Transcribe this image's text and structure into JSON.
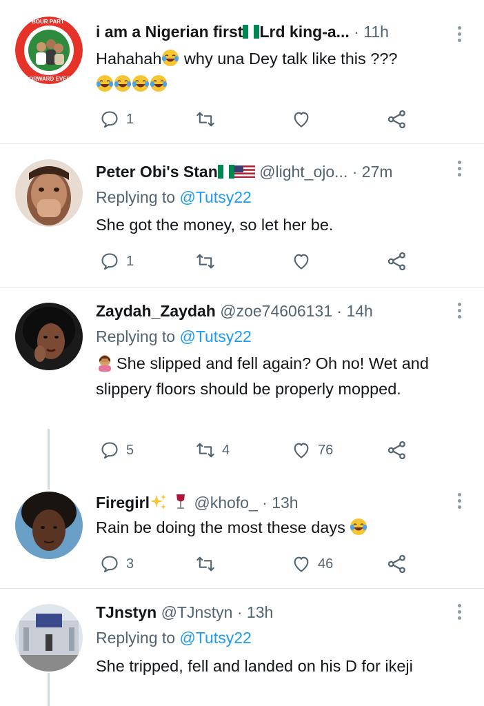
{
  "tweets": [
    {
      "name": "i am a Nigerian first",
      "name_suffix": "Lrd king-a...",
      "handle": "",
      "dot": "·",
      "time": "11h",
      "replying_prefix": "",
      "replying_to": "",
      "text_1": "Hahahah",
      "text_2": " why una Dey talk like this ???",
      "replies": "1",
      "retweets": "",
      "likes": ""
    },
    {
      "name": "Peter Obi's Stan",
      "handle": "@light_ojo...",
      "dot": "·",
      "time": "27m",
      "replying_prefix": "Replying to ",
      "replying_to": "@Tutsy22",
      "text": "She got the money, so let her be.",
      "replies": "1",
      "retweets": "",
      "likes": ""
    },
    {
      "name": "Zaydah_Zaydah",
      "handle": "@zoe74606131",
      "dot": "·",
      "time": "14h",
      "replying_prefix": "Replying to ",
      "replying_to": "@Tutsy22",
      "text": "She slipped and fell again? Oh no! Wet and slippery floors should be properly mopped.",
      "replies": "5",
      "retweets": "4",
      "likes": "76"
    },
    {
      "name": "Firegirl",
      "handle": "@khofo_",
      "dot": "·",
      "time": "13h",
      "text": "Rain be doing the most these days ",
      "replies": "3",
      "retweets": "",
      "likes": "46"
    },
    {
      "name": "TJnstyn",
      "handle": "@TJnstyn",
      "dot": "·",
      "time": "13h",
      "replying_prefix": "Replying to ",
      "replying_to": "@Tutsy22",
      "text": "She tripped, fell and landed on his D for ikeji"
    }
  ],
  "avatar_1_text_top": "BOUR PART",
  "avatar_1_text_bottom": "ORWARD EVER",
  "colors": {
    "accent": "#1d9bf0",
    "muted": "#536471",
    "divider": "#e1e8ed",
    "thread_line": "#cfd9de",
    "nigeria_green": "#008751"
  }
}
